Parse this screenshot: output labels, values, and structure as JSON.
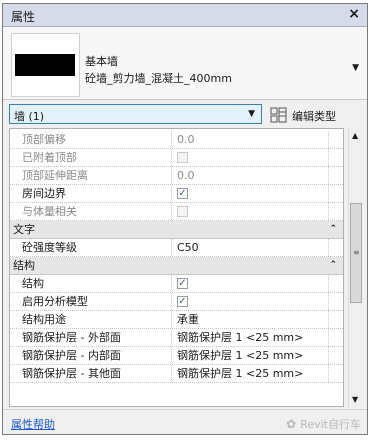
{
  "panel": {
    "title": "属性",
    "close_glyph": "×"
  },
  "type_selector": {
    "family": "基本墙",
    "type_name": "砼墙_剪力墙_混凝土_400mm",
    "dropdown_icon": "chevron-down-icon"
  },
  "filter": {
    "value": "墙 (1)",
    "edit_type_label": "编辑类型"
  },
  "rows": [
    {
      "kind": "prop",
      "name": "顶部偏移",
      "value": "0.0",
      "disabled": true
    },
    {
      "kind": "prop",
      "name": "已附着顶部",
      "checkbox": true,
      "checked": false,
      "disabled": true
    },
    {
      "kind": "prop",
      "name": "顶部延伸距离",
      "value": "0.0",
      "disabled": true
    },
    {
      "kind": "prop",
      "name": "房间边界",
      "checkbox": true,
      "checked": true
    },
    {
      "kind": "prop",
      "name": "与体量相关",
      "checkbox": true,
      "checked": false,
      "disabled": true
    },
    {
      "kind": "group",
      "name": "文字"
    },
    {
      "kind": "prop",
      "name": "砼强度等级",
      "value": "C50"
    },
    {
      "kind": "group",
      "name": "结构"
    },
    {
      "kind": "prop",
      "name": "结构",
      "checkbox": true,
      "checked": true
    },
    {
      "kind": "prop",
      "name": "启用分析模型",
      "checkbox": true,
      "checked": true
    },
    {
      "kind": "prop",
      "name": "结构用途",
      "value": "承重"
    },
    {
      "kind": "prop",
      "name": "钢筋保护层 - 外部面",
      "value": "钢筋保护层 1 <25 mm>"
    },
    {
      "kind": "prop",
      "name": "钢筋保护层 - 内部面",
      "value": "钢筋保护层 1 <25 mm>"
    },
    {
      "kind": "prop",
      "name": "钢筋保护层 - 其他面",
      "value": "钢筋保护层 1 <25 mm>"
    }
  ],
  "footer": {
    "help_link": "属性帮助",
    "watermark": "Revit自行车"
  },
  "colors": {
    "titlebar": "#d6dbe9",
    "selector_border": "#3c7fb1",
    "link": "#1a59c8"
  }
}
